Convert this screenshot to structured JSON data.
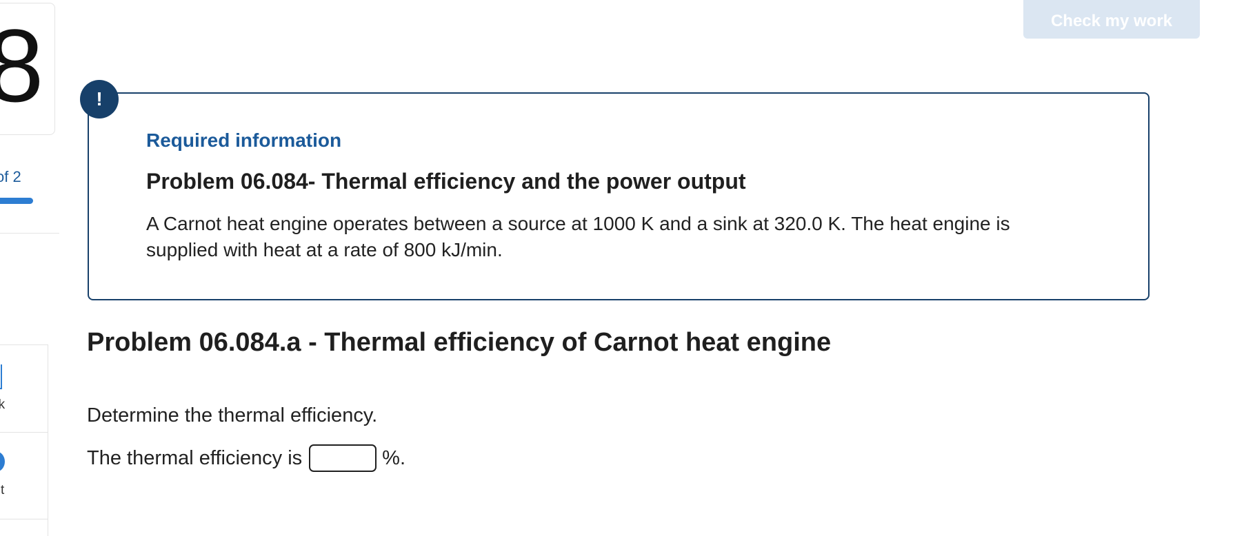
{
  "sidebar": {
    "question_number": "8",
    "part_indicator": "of 2",
    "part_progress": 0.5,
    "tools": [
      {
        "label": "ok",
        "icon": "ebook-icon"
      },
      {
        "label": "t",
        "icon": "print-icon"
      }
    ]
  },
  "header": {
    "check_button_label": "Check my work"
  },
  "info_box": {
    "badge": "!",
    "heading": "Required information",
    "title": "Problem 06.084- Thermal efficiency and the power output",
    "body": "A Carnot heat engine operates between a source at 1000 K and a sink at 320.0 K. The heat engine is supplied with heat at a rate of 800 kJ/min."
  },
  "problem": {
    "title": "Problem 06.084.a - Thermal efficiency of Carnot heat engine",
    "prompt": "Determine the thermal efficiency.",
    "answer_prefix": "The thermal efficiency is",
    "answer_value": "",
    "answer_suffix": "%."
  },
  "colors": {
    "accent": "#17406a",
    "link_blue": "#1b5a9a",
    "progress_blue": "#2d7dd2",
    "disabled_button_bg": "#dbe6f2"
  }
}
